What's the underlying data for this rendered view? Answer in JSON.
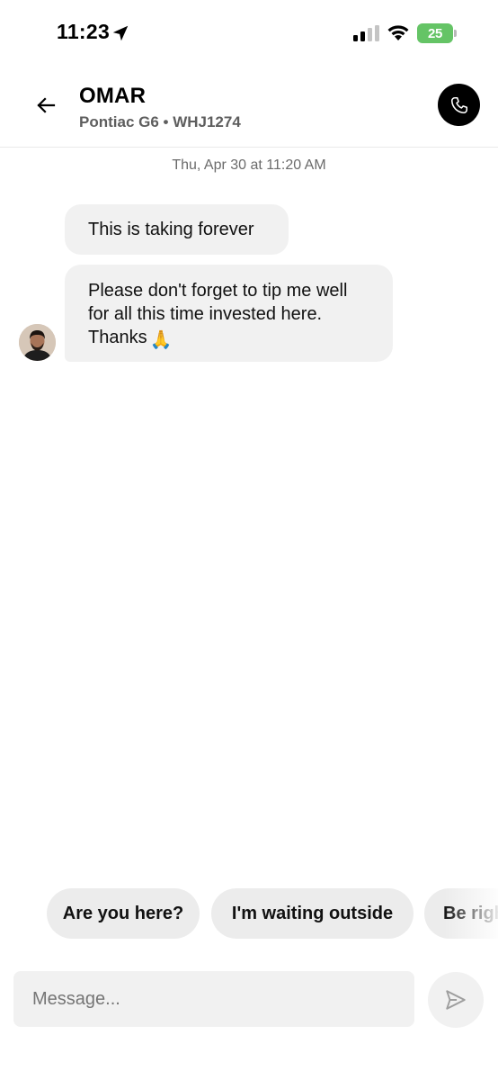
{
  "status_bar": {
    "time": "11:23",
    "battery": "25",
    "icons": [
      "location-arrow-icon",
      "cellular-signal-icon",
      "wifi-icon",
      "battery-charging-icon"
    ],
    "battery_color": "#65c466"
  },
  "header": {
    "driver_name": "OMAR",
    "vehicle": "Pontiac G6 • WHJ1274",
    "back_icon": "arrow-left-icon",
    "call_icon": "phone-icon"
  },
  "conversation": {
    "timestamp": "Thu, Apr 30 at 11:20 AM",
    "messages": [
      {
        "text": "This is taking forever"
      },
      {
        "text": "Please don't forget to tip me well for all this time invested here. Thanks",
        "emoji": "🙏"
      }
    ]
  },
  "quick_replies": [
    "Are you here?",
    "I'm waiting outside",
    "Be right"
  ],
  "composer": {
    "placeholder": "Message...",
    "send_icon": "send-icon"
  },
  "colors": {
    "bubble": "#f1f1f1",
    "chip": "#ececec",
    "call_button": "#000000"
  }
}
